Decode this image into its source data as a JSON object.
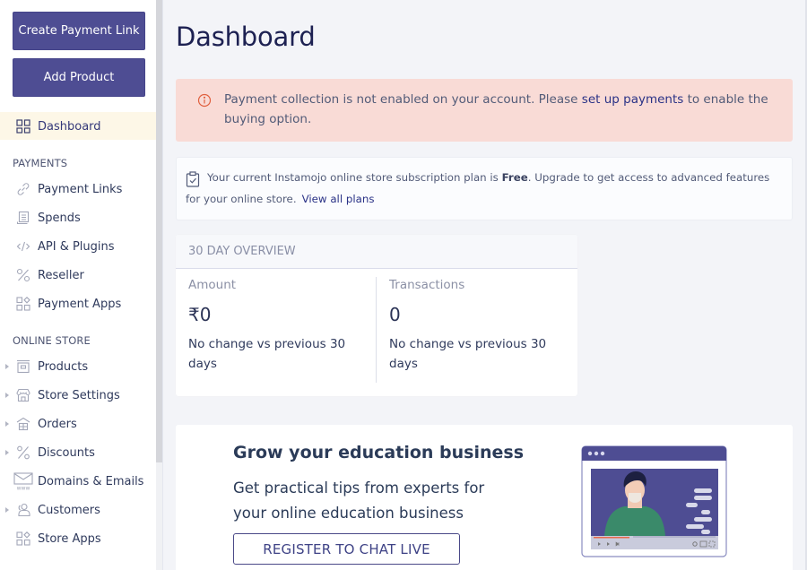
{
  "sidebar": {
    "create_payment_link": "Create Payment Link",
    "add_product": "Add Product",
    "dashboard": {
      "label": "Dashboard",
      "icon": "dashboard-grid-icon",
      "active": true
    },
    "sections": [
      {
        "title": "PAYMENTS",
        "items": [
          {
            "label": "Payment Links",
            "icon": "link-icon"
          },
          {
            "label": "Spends",
            "icon": "receipt-icon"
          },
          {
            "label": "API & Plugins",
            "icon": "code-icon"
          },
          {
            "label": "Reseller",
            "icon": "percent-icon"
          },
          {
            "label": "Payment Apps",
            "icon": "apps-icon"
          }
        ]
      },
      {
        "title": "ONLINE STORE",
        "items": [
          {
            "label": "Products",
            "icon": "box-icon",
            "expandable": true
          },
          {
            "label": "Store Settings",
            "icon": "storefront-icon",
            "expandable": true
          },
          {
            "label": "Orders",
            "icon": "package-icon",
            "expandable": true
          },
          {
            "label": "Discounts",
            "icon": "percent-icon",
            "expandable": true
          },
          {
            "label": "Domains & Emails",
            "icon": "envelope-www-icon",
            "expandable": false
          },
          {
            "label": "Customers",
            "icon": "users-icon",
            "expandable": true
          },
          {
            "label": "Store Apps",
            "icon": "apps-icon",
            "expandable": false
          }
        ]
      }
    ]
  },
  "main": {
    "title": "Dashboard",
    "alert": {
      "icon": "info-circle-icon",
      "text_before": "Payment collection is not enabled on your account. Please ",
      "link": "set up payments",
      "text_after": " to enable the buying option."
    },
    "plan_notice": {
      "icon": "clipboard-check-icon",
      "text_before": "Your current Instamojo online store subscription plan is ",
      "plan": "Free",
      "text_after": ". Upgrade to get access to advanced features for your online store.",
      "link": "View all plans"
    },
    "overview": {
      "title": "30 DAY OVERVIEW",
      "metrics": [
        {
          "label": "Amount",
          "currency": "₹",
          "value": "0",
          "change": "No change vs previous 30 days"
        },
        {
          "label": "Transactions",
          "value": "0",
          "change": "No change vs previous 30 days"
        }
      ]
    },
    "promo": {
      "title": "Grow your education business",
      "subtitle": "Get practical tips from experts for your online education business",
      "cta": "REGISTER TO CHAT LIVE",
      "illustration": "video-call-illustration"
    }
  },
  "colors": {
    "brand": "#4e4d93",
    "alert_bg": "#f9dbd6",
    "alert_icon": "#e0603f",
    "link": "#2a3286",
    "active_nav_bg": "#fdf7e7"
  }
}
